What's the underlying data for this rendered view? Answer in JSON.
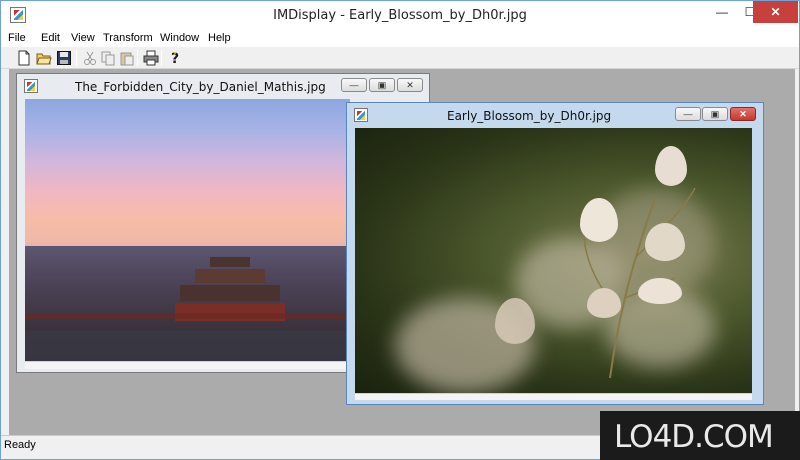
{
  "window": {
    "title": "IMDisplay - Early_Blossom_by_Dh0r.jpg",
    "min_glyph": "—",
    "max_glyph": "☐",
    "close_glyph": "✕"
  },
  "menu": {
    "items": [
      "File",
      "Edit",
      "View",
      "Transform",
      "Window",
      "Help"
    ]
  },
  "toolbar": {
    "icons": [
      "new-icon",
      "open-icon",
      "save-icon",
      "cut-icon",
      "copy-icon",
      "paste-icon",
      "print-icon",
      "help-icon"
    ]
  },
  "child_windows": [
    {
      "caption": "The_Forbidden_City_by_Daniel_Mathis.jpg",
      "state": "inactive",
      "min_glyph": "—",
      "restore_glyph": "▣",
      "close_glyph": "✕"
    },
    {
      "caption": "Early_Blossom_by_Dh0r.jpg",
      "state": "active",
      "min_glyph": "—",
      "restore_glyph": "▣",
      "close_glyph": "✕"
    }
  ],
  "status": {
    "text": "Ready"
  },
  "watermark": {
    "text": "LO4D.COM"
  },
  "colors": {
    "close_red": "#c7403d",
    "active_frame": "#c4d9ee",
    "mdi_background": "#ababab"
  }
}
